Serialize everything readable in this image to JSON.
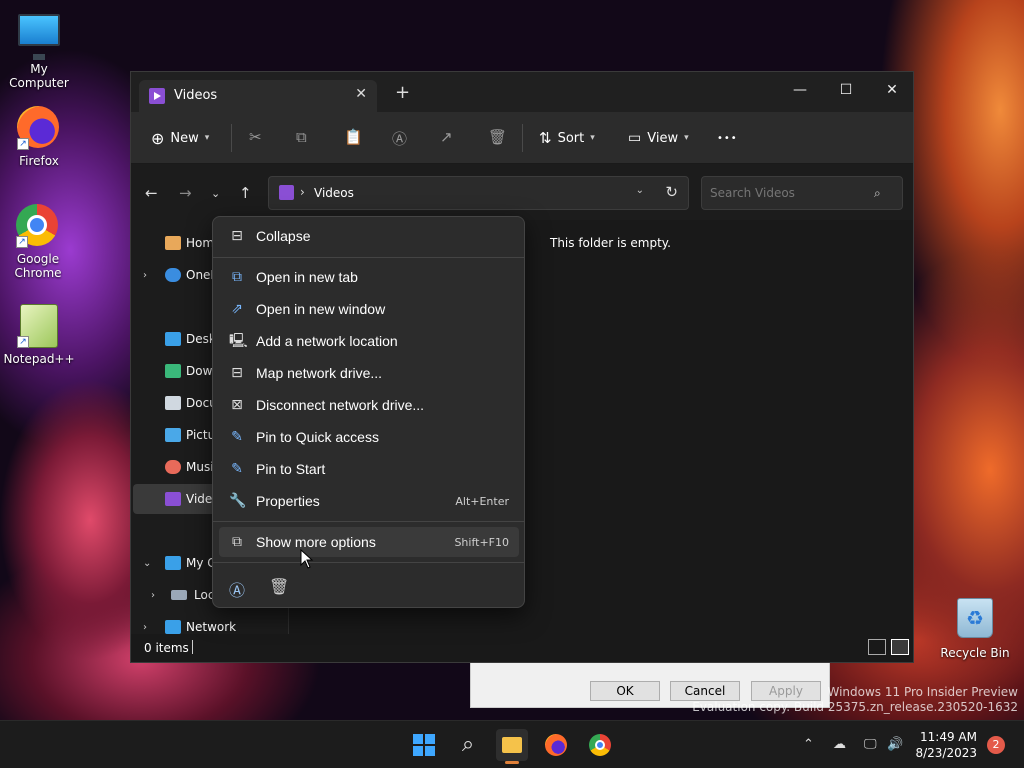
{
  "desktop": {
    "icons": [
      {
        "label": "My Computer"
      },
      {
        "label": "Firefox"
      },
      {
        "label": "Google Chrome"
      },
      {
        "label": "Notepad++"
      },
      {
        "label": "Recycle Bin"
      }
    ]
  },
  "window": {
    "tab_title": "Videos",
    "new_tab_glyph": "+",
    "controls": {
      "minimize": "—",
      "maximize": "☐",
      "close": "✕"
    },
    "toolbar": {
      "new_label": "New",
      "sort_label": "Sort",
      "view_label": "View",
      "more_glyph": "•••"
    },
    "address": {
      "path": "Videos"
    },
    "search": {
      "placeholder": "Search Videos"
    },
    "sidebar": {
      "items": [
        {
          "label": "Home",
          "icon": "home-icon"
        },
        {
          "label": "OneD",
          "icon": "onedrive-icon"
        },
        {
          "label": "Deskt",
          "icon": "desktop-folder-icon"
        },
        {
          "label": "Down",
          "icon": "downloads-icon"
        },
        {
          "label": "Docu",
          "icon": "documents-icon"
        },
        {
          "label": "Pictu",
          "icon": "pictures-icon"
        },
        {
          "label": "Musi",
          "icon": "music-icon"
        },
        {
          "label": "Video",
          "icon": "videos-icon"
        },
        {
          "label": "My C",
          "icon": "computer-icon"
        },
        {
          "label": "Loc",
          "icon": "local-disk-icon"
        },
        {
          "label": "Network",
          "icon": "network-icon"
        }
      ]
    },
    "content": {
      "empty_message": "This folder is empty."
    },
    "status": {
      "item_count": "0 items"
    }
  },
  "context_menu": {
    "items": [
      {
        "label": "Collapse",
        "icon": "collapse-icon",
        "shortcut": ""
      },
      {
        "label": "Open in new tab",
        "icon": "new-tab-icon",
        "shortcut": ""
      },
      {
        "label": "Open in new window",
        "icon": "new-window-icon",
        "shortcut": ""
      },
      {
        "label": "Add a network location",
        "icon": "network-location-icon",
        "shortcut": ""
      },
      {
        "label": "Map network drive...",
        "icon": "map-drive-icon",
        "shortcut": ""
      },
      {
        "label": "Disconnect network drive...",
        "icon": "disconnect-drive-icon",
        "shortcut": ""
      },
      {
        "label": "Pin to Quick access",
        "icon": "pin-icon",
        "shortcut": ""
      },
      {
        "label": "Pin to Start",
        "icon": "pin-icon",
        "shortcut": ""
      },
      {
        "label": "Properties",
        "icon": "wrench-icon",
        "shortcut": "Alt+Enter"
      },
      {
        "label": "Show more options",
        "icon": "more-options-icon",
        "shortcut": "Shift+F10"
      }
    ]
  },
  "background_dialog": {
    "ok_label": "OK",
    "cancel_label": "Cancel",
    "apply_label": "Apply"
  },
  "watermark": {
    "line1": "Windows 11 Pro Insider Preview",
    "line2": "Evaluation copy. Build 25375.zn_release.230520-1632"
  },
  "taskbar": {
    "time": "11:49 AM",
    "date": "8/23/2023",
    "notification_count": "2"
  },
  "colors": {
    "accent": "#3ea7ff",
    "window_bg": "#191919",
    "menu_bg": "#2c2c2c"
  }
}
